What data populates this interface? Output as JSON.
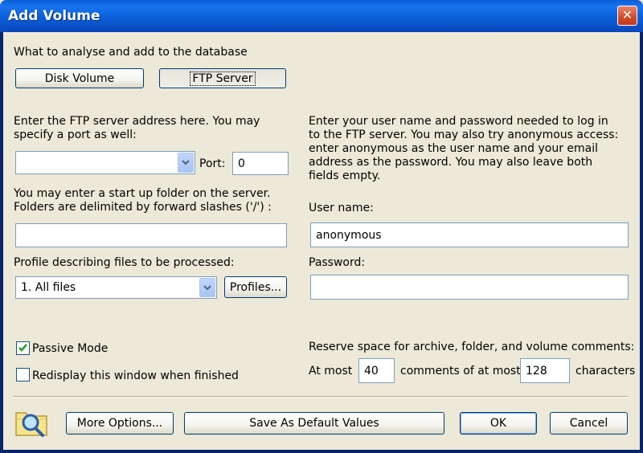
{
  "window": {
    "title": "Add Volume",
    "close_glyph": "✕"
  },
  "source": {
    "prompt": "What to analyse and add to the database",
    "disk_button": "Disk Volume",
    "ftp_button": "FTP Server"
  },
  "ftp": {
    "address_prompt": "Enter the FTP server address here. You may specify a port as well:",
    "address_value": "",
    "port_label": "Port:",
    "port_value": "0",
    "folder_prompt": "You may enter a start up folder on the server. Folders are delimited by forward slashes ('/') :",
    "folder_value": "",
    "profile_label": "Profile describing files to be processed:",
    "profile_value": "1. All files",
    "profiles_button": "Profiles..."
  },
  "login": {
    "prompt": "Enter your user name and password needed to log in to the FTP server. You may also try anonymous access: enter anonymous as the user name and your email address as the password. You may also leave both fields empty.",
    "username_label": "User name:",
    "username_value": "anonymous",
    "password_label": "Password:",
    "password_value": ""
  },
  "options": {
    "passive_mode_label": "Passive Mode",
    "passive_mode_checked": true,
    "redisplay_label": "Redisplay this window when finished",
    "redisplay_checked": false
  },
  "reserve": {
    "prompt": "Reserve space for archive, folder, and volume comments:",
    "at_most_label": "At most",
    "comments_value": "40",
    "comments_label": "comments of at most",
    "characters_value": "128",
    "characters_label": "characters"
  },
  "footer": {
    "more_options_button": "More Options...",
    "save_default_button": "Save As Default Values",
    "ok_button": "OK",
    "cancel_button": "Cancel"
  },
  "icons": {
    "title_close": "close-icon",
    "search": "magnifier-folder-icon",
    "dropdown": "chevron-down-icon",
    "check": "checkmark-icon"
  }
}
